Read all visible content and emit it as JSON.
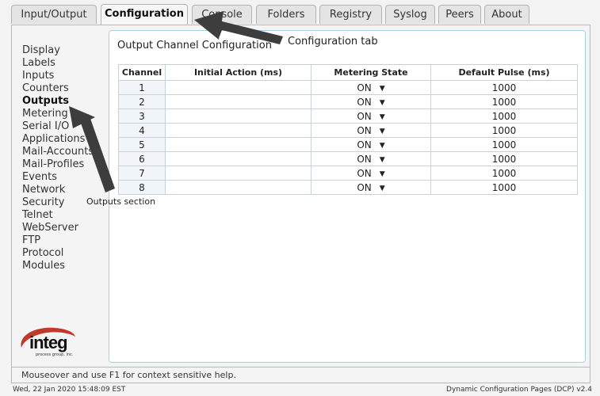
{
  "tabs": [
    {
      "label": "Input/Output",
      "active": false
    },
    {
      "label": "Configuration",
      "active": true
    },
    {
      "label": "Console",
      "active": false
    },
    {
      "label": "Folders",
      "active": false
    },
    {
      "label": "Registry",
      "active": false
    },
    {
      "label": "Syslog",
      "active": false
    },
    {
      "label": "Peers",
      "active": false
    },
    {
      "label": "About",
      "active": false
    }
  ],
  "sidebar": {
    "items": [
      {
        "label": "Display"
      },
      {
        "label": "Labels"
      },
      {
        "label": "Inputs"
      },
      {
        "label": "Counters"
      },
      {
        "label": "Outputs",
        "active": true
      },
      {
        "label": "Metering"
      },
      {
        "label": "Serial I/O"
      },
      {
        "label": "Applications"
      },
      {
        "label": "Mail-Accounts"
      },
      {
        "label": "Mail-Profiles"
      },
      {
        "label": "Events"
      },
      {
        "label": "Network"
      },
      {
        "label": "Security"
      },
      {
        "label": "Telnet"
      },
      {
        "label": "WebServer"
      },
      {
        "label": "FTP"
      },
      {
        "label": "Protocol"
      },
      {
        "label": "Modules"
      }
    ]
  },
  "panel": {
    "title": "Output Channel Configuration"
  },
  "table": {
    "headers": [
      "Channel",
      "Initial Action (ms)",
      "Metering State",
      "Default Pulse (ms)"
    ],
    "rows": [
      {
        "channel": "1",
        "initial": "",
        "metering": "ON",
        "pulse": "1000"
      },
      {
        "channel": "2",
        "initial": "",
        "metering": "ON",
        "pulse": "1000"
      },
      {
        "channel": "3",
        "initial": "",
        "metering": "ON",
        "pulse": "1000"
      },
      {
        "channel": "4",
        "initial": "",
        "metering": "ON",
        "pulse": "1000"
      },
      {
        "channel": "5",
        "initial": "",
        "metering": "ON",
        "pulse": "1000"
      },
      {
        "channel": "6",
        "initial": "",
        "metering": "ON",
        "pulse": "1000"
      },
      {
        "channel": "7",
        "initial": "",
        "metering": "ON",
        "pulse": "1000"
      },
      {
        "channel": "8",
        "initial": "",
        "metering": "ON",
        "pulse": "1000"
      }
    ]
  },
  "logo": {
    "name": "integ",
    "subtitle": "process group, inc.",
    "color": "#c0392b"
  },
  "status": {
    "help": "Mouseover and use F1 for context sensitive help."
  },
  "footer": {
    "datetime": "Wed, 22 Jan 2020 15:48:09 EST",
    "product": "Dynamic Configuration Pages (DCP) v2.4"
  },
  "annotations": {
    "config_tab": "Configuration tab",
    "outputs_section": "Outputs section"
  }
}
